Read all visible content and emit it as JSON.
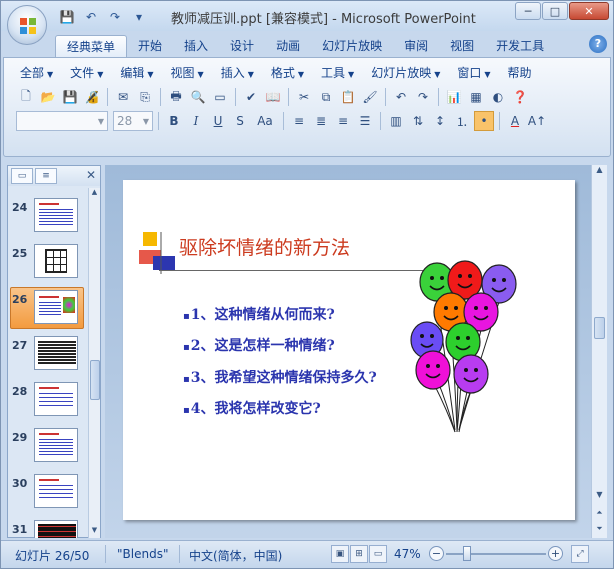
{
  "window": {
    "title": "教师减压训.ppt [兼容模式] - Microsoft PowerPoint",
    "minimize": "─",
    "maximize": "□",
    "close": "✕"
  },
  "qat": {
    "save": "💾",
    "undo": "↶",
    "redo": "↷",
    "customize": "▾"
  },
  "tabs": [
    "经典菜单",
    "开始",
    "插入",
    "设计",
    "动画",
    "幻灯片放映",
    "审阅",
    "视图",
    "开发工具"
  ],
  "help": "?",
  "menus": [
    "全部",
    "文件",
    "编辑",
    "视图",
    "插入",
    "格式",
    "工具",
    "幻灯片放映",
    "窗口",
    "帮助"
  ],
  "toolbar": {
    "font_name": "",
    "font_size": "28",
    "bold": "B",
    "italic": "I",
    "underline": "U",
    "shadow": "S",
    "change_case": "Aa"
  },
  "panel": {
    "outline_tab": "≡",
    "slides_tab": "▭",
    "close": "✕",
    "thumbs": [
      {
        "num": "24",
        "selected": false
      },
      {
        "num": "25",
        "selected": false
      },
      {
        "num": "26",
        "selected": true
      },
      {
        "num": "27",
        "selected": false
      },
      {
        "num": "28",
        "selected": false
      },
      {
        "num": "29",
        "selected": false
      },
      {
        "num": "30",
        "selected": false
      },
      {
        "num": "31",
        "selected": false
      }
    ]
  },
  "slide": {
    "title": "驱除坏情绪的新方法",
    "bullets": [
      "1、这种情绪从何而来?",
      "2、这是怎样一种情绪?",
      "3、我希望这种情绪保持多久?",
      "4、我将怎样改变它?"
    ],
    "bullet_mark": "▪",
    "colors": {
      "title": "#cc3b1f",
      "bullets": "#2b35ae"
    }
  },
  "status": {
    "slide_info": "幻灯片 26/50",
    "theme": "\"Blends\"",
    "language": "中文(简体，中国)",
    "zoom": "47%",
    "zoom_out": "−",
    "zoom_in": "+",
    "fit": "⤢"
  }
}
